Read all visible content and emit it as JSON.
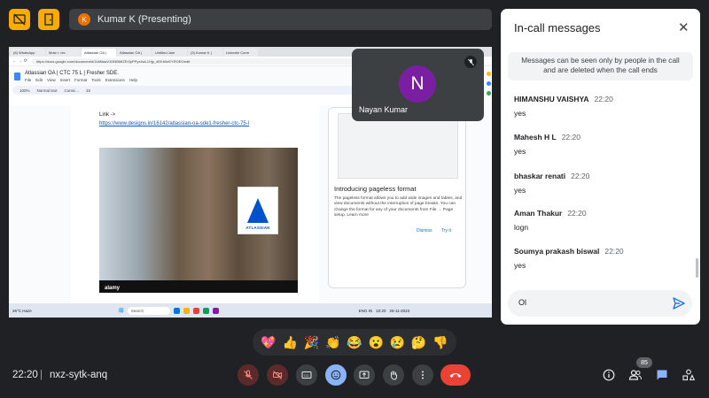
{
  "presenting": {
    "avatar_letter": "K",
    "label": "Kumar K (Presenting)"
  },
  "shared_screen": {
    "tabs": [
      "(6) WhatsApp",
      "Most r. rec",
      "Atlassian OA |",
      "Atlassian OA |",
      "Untitled Jam",
      "(3) Kumar K |",
      "LinkedIn Corre"
    ],
    "url": "https://docs.google.com/document/d/1kIiMaaV1i3NBMIZEr3yPPyx4wL1Hjp_dEKb0eEYROE0/edit",
    "doc_title": "Atlassian OA | CTC 75 L | Fresher SDE.",
    "doc_menu": [
      "File",
      "Edit",
      "View",
      "Insert",
      "Format",
      "Tools",
      "Extensions",
      "Help"
    ],
    "toolbar": {
      "zoom": "100%",
      "style": "Normal text",
      "font": "Comic...",
      "size": "15"
    },
    "link_label": "Link ->",
    "link_url": "https://www.designs.in/16142/atlassian-oa-sde1-fresher-ctc-75-l",
    "image": {
      "watermark": "alamy",
      "logo_text": "ATLASSIAN"
    },
    "pageless": {
      "title": "Introducing pageless format",
      "body": "The pageless format allows you to add wide images and tables, and view documents without the interruption of page breaks. You can change the format for any of your documents from File → Page setup. Learn more",
      "dismiss": "Dismiss",
      "try": "Try it"
    },
    "taskbar": {
      "weather": "26°C Haze",
      "search": "Search",
      "lang": "ENG IN",
      "time": "22:20",
      "date": "25-11-2023"
    }
  },
  "participant_tile": {
    "initial": "N",
    "name": "Nayan Kumar"
  },
  "panel": {
    "title": "In-call messages",
    "notice": "Messages can be seen only by people in the call and are deleted when the call ends",
    "messages": [
      {
        "name": "HIMANSHU VAISHYA",
        "time": "22:20",
        "text": "yes"
      },
      {
        "name": "Mahesh H L",
        "time": "22:20",
        "text": "yes"
      },
      {
        "name": "bhaskar renati",
        "time": "22:20",
        "text": "yes"
      },
      {
        "name": "Aman Thakur",
        "time": "22:20",
        "text": "logn"
      },
      {
        "name": "Soumya prakash biswal",
        "time": "22:20",
        "text": "yes"
      }
    ],
    "compose_value": "Ol"
  },
  "reactions": [
    "💖",
    "👍",
    "🎉",
    "👏",
    "😂",
    "😮",
    "😢",
    "🤔",
    "👎"
  ],
  "bottom": {
    "time": "22:20",
    "separator": "|",
    "meeting_code": "nxz-sytk-anq",
    "participants_count": "85"
  },
  "colors": {
    "background": "#202124",
    "accent_yellow": "#f9ab00",
    "hangup_red": "#ea4335",
    "muted_red": "#5c2b29",
    "active_blue": "#8ab4f8"
  }
}
